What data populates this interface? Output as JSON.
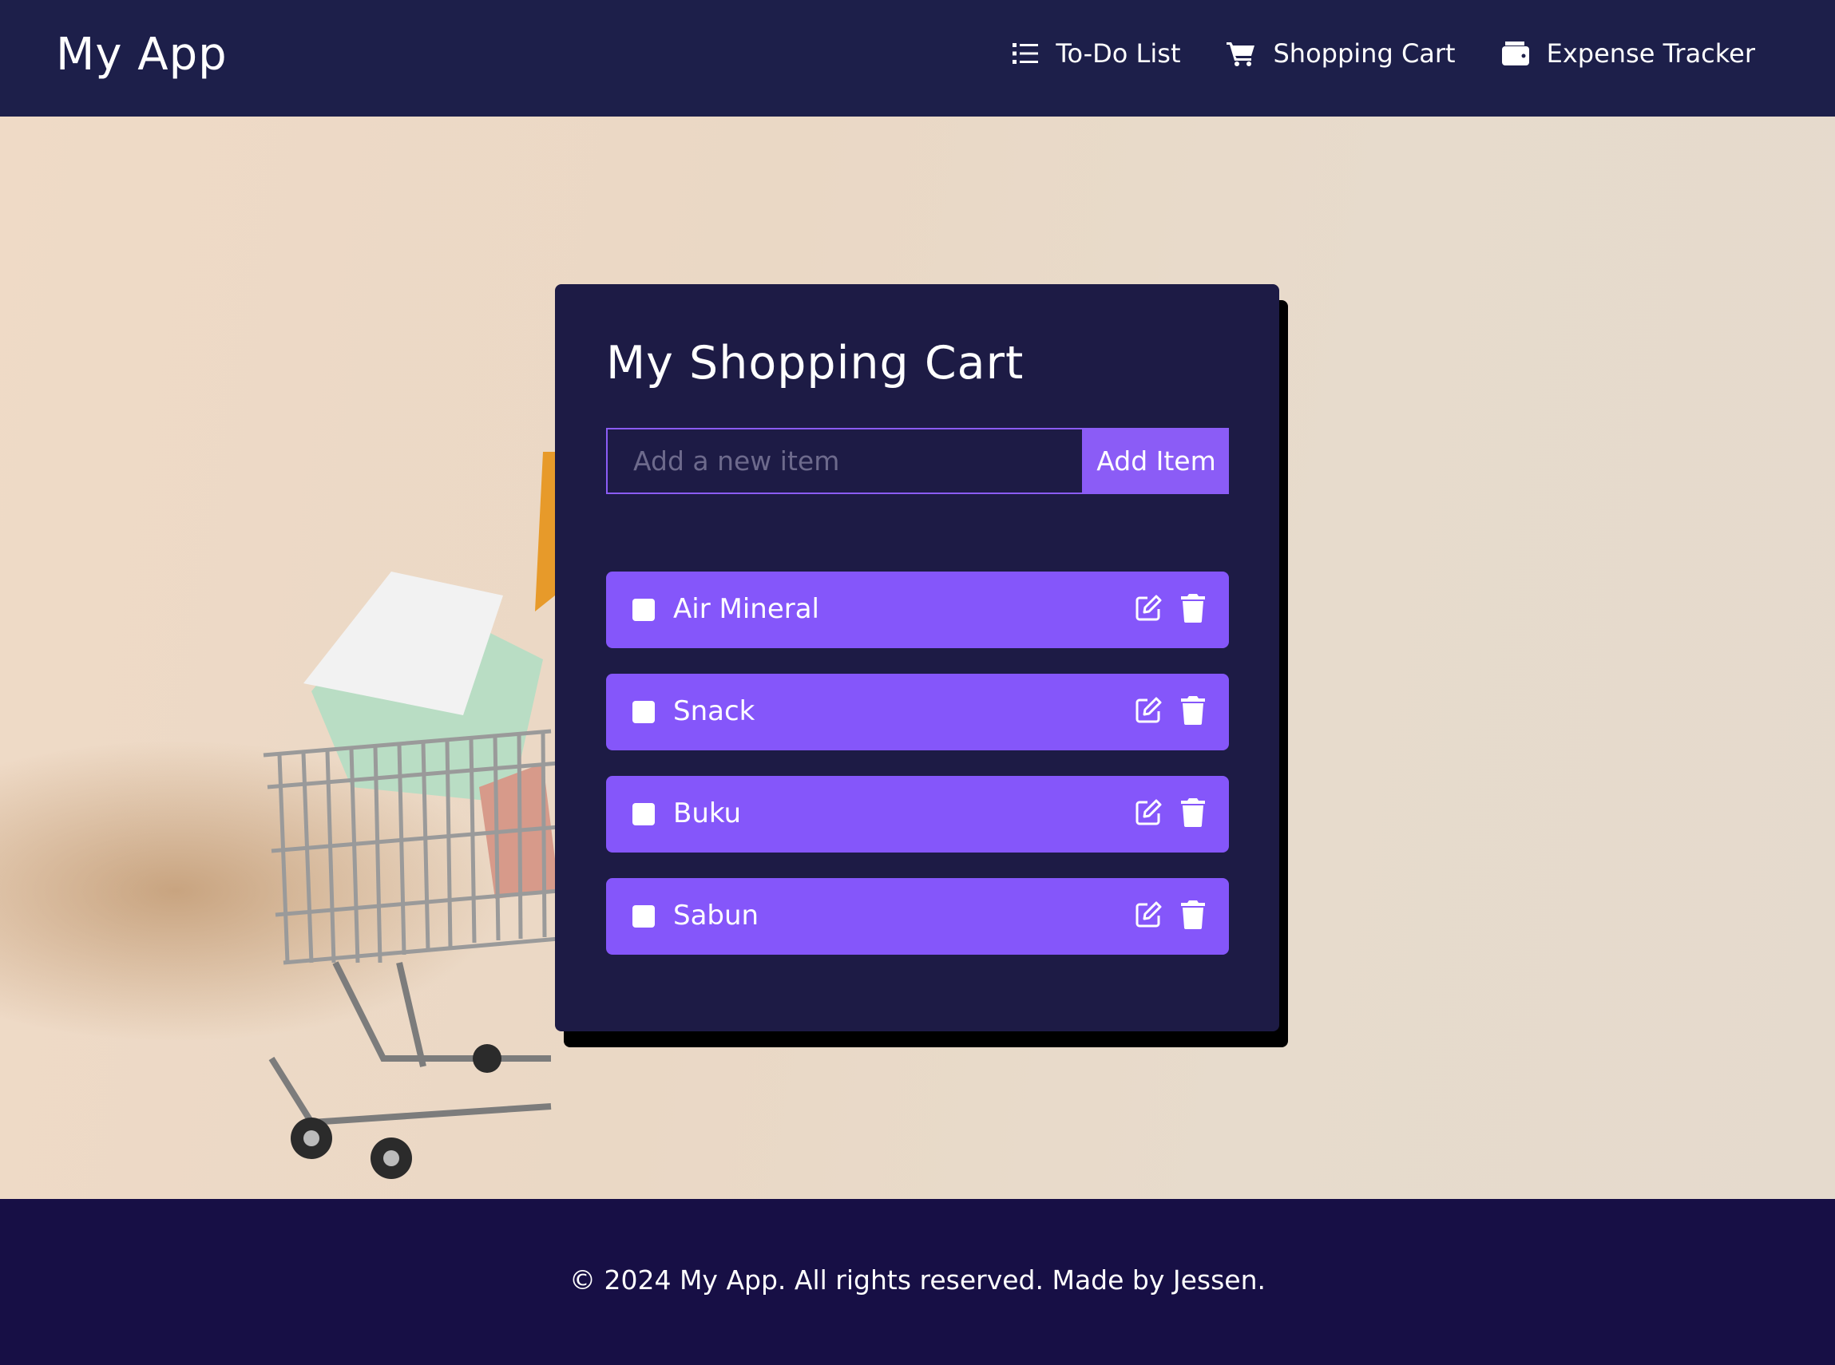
{
  "header": {
    "brand": "My App",
    "nav": [
      {
        "label": "To-Do List",
        "icon": "list-icon"
      },
      {
        "label": "Shopping Cart",
        "icon": "cart-icon"
      },
      {
        "label": "Expense Tracker",
        "icon": "wallet-icon"
      }
    ]
  },
  "card": {
    "title": "My Shopping Cart",
    "input": {
      "placeholder": "Add a new item",
      "value": ""
    },
    "add_button": "Add Item",
    "items": [
      {
        "label": "Air Mineral",
        "checked": false
      },
      {
        "label": "Snack",
        "checked": false
      },
      {
        "label": "Buku",
        "checked": false
      },
      {
        "label": "Sabun",
        "checked": false
      }
    ]
  },
  "footer": {
    "text": "© 2024 My App. All rights reserved. Made by Jessen."
  },
  "colors": {
    "header_bg": "#1d1f4a",
    "card_bg": "#1d1b45",
    "accent": "#8b5cf6",
    "item_bg": "#8556fa",
    "footer_bg": "#170f45",
    "page_bg": "#e8dccb"
  }
}
